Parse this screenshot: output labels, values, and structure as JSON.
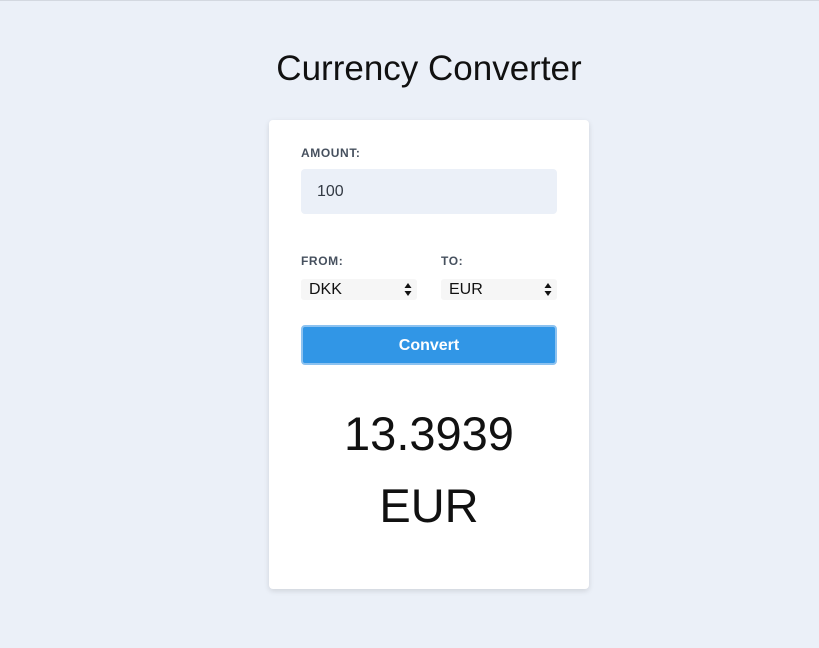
{
  "page": {
    "title": "Currency Converter"
  },
  "form": {
    "amount_label": "AMOUNT:",
    "amount_value": "100",
    "from_label": "FROM:",
    "from_value": "DKK",
    "to_label": "TO:",
    "to_value": "EUR",
    "convert_label": "Convert"
  },
  "result": {
    "value": "13.3939",
    "currency": "EUR"
  },
  "colors": {
    "background": "#ebf0f8",
    "button": "#3196e6",
    "button_border": "#8cc2f0",
    "label": "#46505e"
  },
  "icons": {
    "select_arrows": "up-down-arrows-icon"
  }
}
